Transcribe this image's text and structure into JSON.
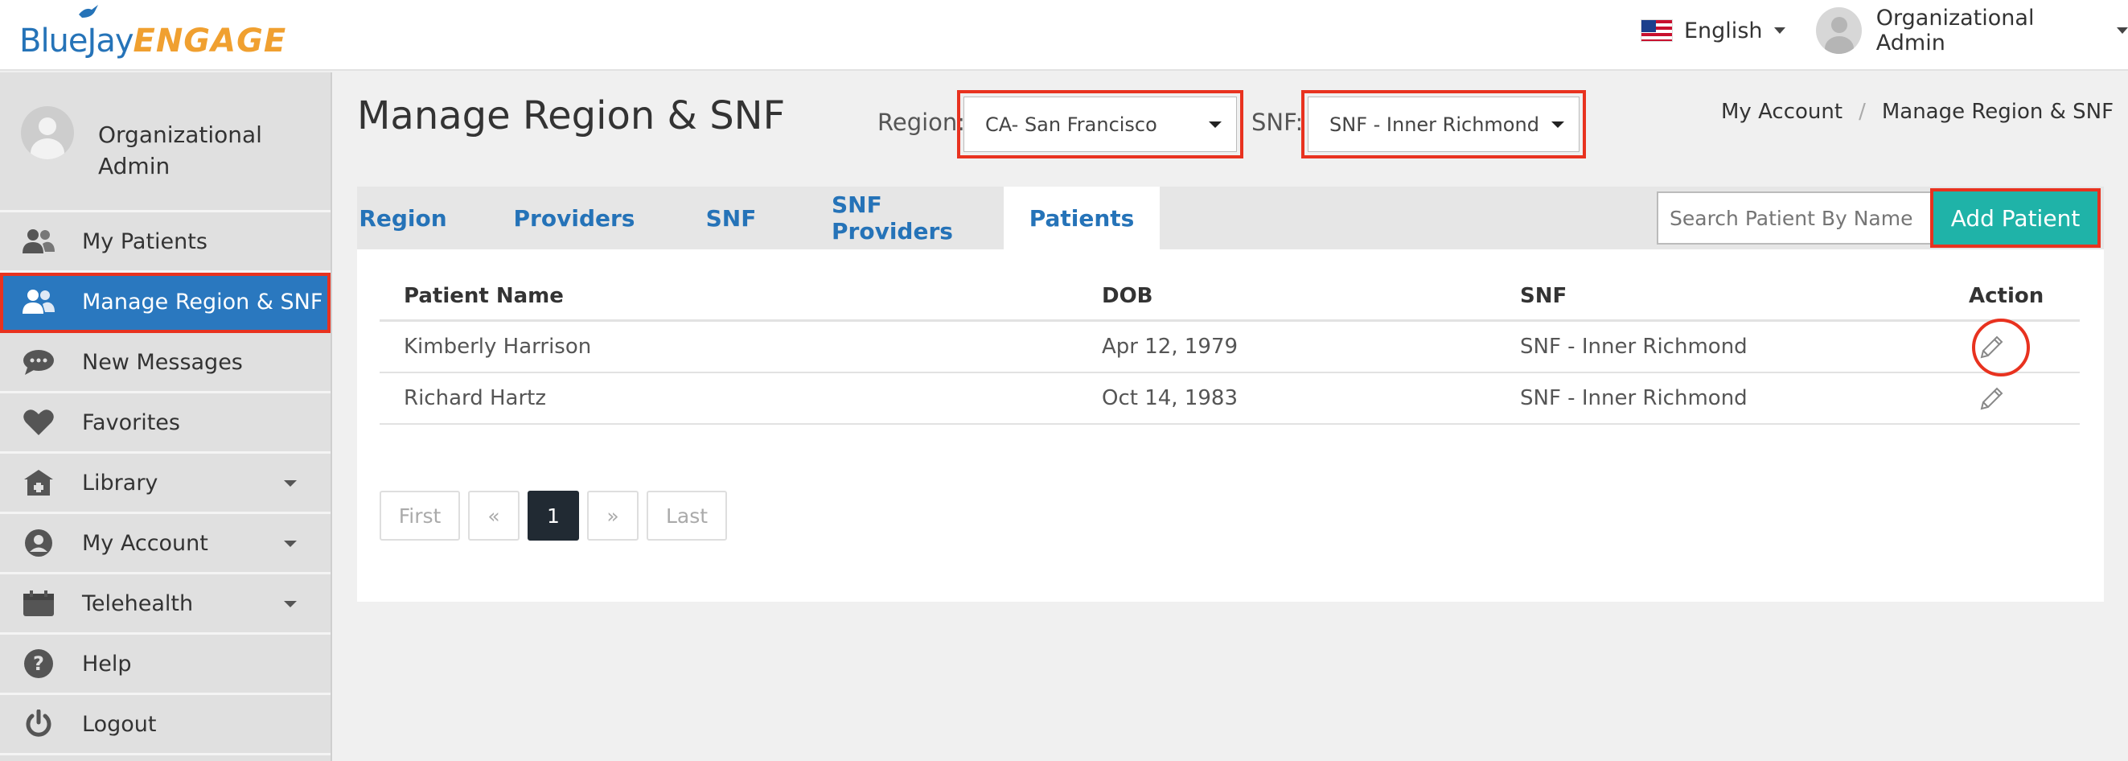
{
  "header": {
    "logo_primary": "BlueJay",
    "logo_secondary": "ENGAGE",
    "language": "English",
    "user": "Organizational Admin"
  },
  "sidebar": {
    "profile_name": "Organizational Admin",
    "items": [
      {
        "label": "My Patients",
        "icon": "patients-icon"
      },
      {
        "label": "Manage Region & SNF",
        "icon": "users-icon",
        "active": true
      },
      {
        "label": "New Messages",
        "icon": "chat-icon"
      },
      {
        "label": "Favorites",
        "icon": "heart-icon"
      },
      {
        "label": "Library",
        "icon": "library-icon",
        "expandable": true
      },
      {
        "label": "My Account",
        "icon": "account-icon",
        "expandable": true
      },
      {
        "label": "Telehealth",
        "icon": "calendar-icon",
        "expandable": true
      },
      {
        "label": "Help",
        "icon": "help-icon"
      },
      {
        "label": "Logout",
        "icon": "power-icon"
      }
    ]
  },
  "main": {
    "title": "Manage Region & SNF",
    "region_label": "Region:",
    "region_value": "CA- San Francisco",
    "snf_label": "SNF:",
    "snf_value": "SNF - Inner Richmond",
    "breadcrumb": [
      "My Account",
      "Manage Region & SNF"
    ],
    "tabs": [
      "Region",
      "Providers",
      "SNF",
      "SNF Providers",
      "Patients"
    ],
    "active_tab": "Patients",
    "search_placeholder": "Search Patient By Name",
    "add_button": "Add Patient",
    "table": {
      "headers": [
        "Patient Name",
        "DOB",
        "SNF",
        "Action"
      ],
      "rows": [
        {
          "name": "Kimberly Harrison",
          "dob": "Apr 12, 1979",
          "snf": "SNF - Inner Richmond"
        },
        {
          "name": "Richard Hartz",
          "dob": "Oct 14, 1983",
          "snf": "SNF - Inner Richmond"
        }
      ]
    },
    "pagination": [
      "First",
      "«",
      "1",
      "»",
      "Last"
    ],
    "current_page": "1"
  },
  "colors": {
    "primary_blue": "#2a78bf",
    "accent_teal": "#1fb3a8",
    "highlight_red": "#e8321f",
    "logo_orange": "#f0a030"
  }
}
